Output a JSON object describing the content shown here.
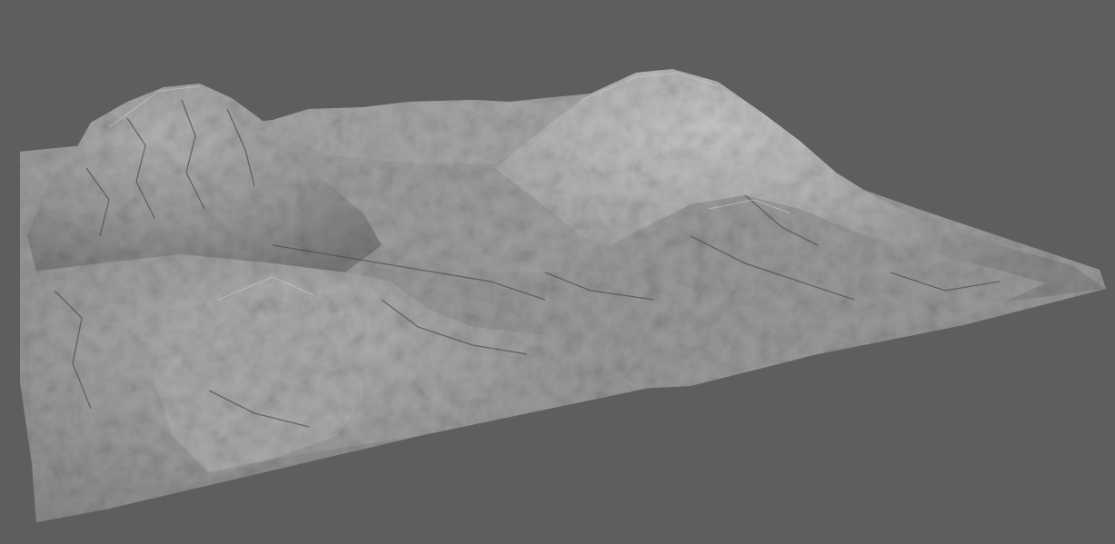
{
  "viewport": {
    "background_color": "#5e5e5e",
    "render_mode": "smooth-shaded",
    "object": "terrain-heightmap-mesh"
  },
  "terrain": {
    "base_color": "#a0a0a0",
    "highlight_color": "#c8c8c8",
    "shadow_color": "#3c3c3c",
    "features": [
      "left-rocky-peak",
      "right-smooth-peak",
      "central-valley",
      "front-hills",
      "right-ridges"
    ]
  }
}
